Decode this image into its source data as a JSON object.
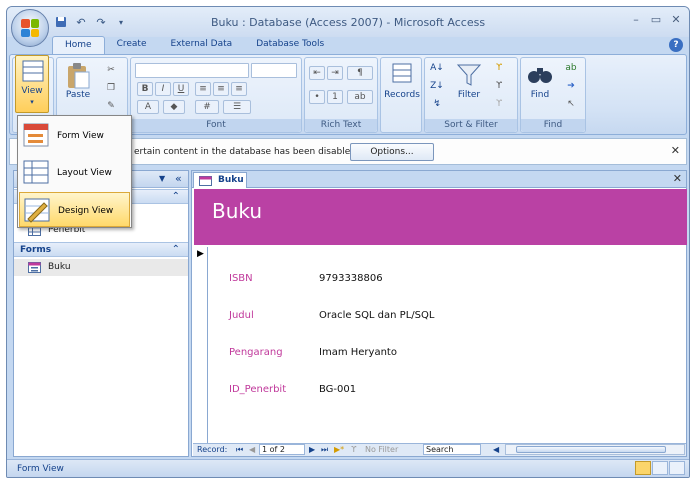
{
  "window": {
    "title": "Buku : Database (Access 2007) - Microsoft Access"
  },
  "ribbon_tabs": [
    "Home",
    "Create",
    "External Data",
    "Database Tools"
  ],
  "ribbon": {
    "view_label": "View",
    "paste_label": "Paste",
    "font_group": "Font",
    "rich_text_group": "Rich Text",
    "records_label": "Records",
    "filter_label": "Filter",
    "sort_filter_group": "Sort & Filter",
    "find_label": "Find",
    "find_group": "Find"
  },
  "security_bar": {
    "message": "ertain content in the database has been disabled",
    "options_label": "Options..."
  },
  "view_menu": [
    {
      "label": "Form View"
    },
    {
      "label": "Layout View"
    },
    {
      "label": "Design View"
    }
  ],
  "nav_pane": {
    "tables_item": "Penerbit",
    "forms_section": "Forms",
    "forms_item": "Buku"
  },
  "document": {
    "tab_label": "Buku",
    "form_title": "Buku",
    "fields": [
      {
        "label": "ISBN",
        "value": "9793338806"
      },
      {
        "label": "Judul",
        "value": "Oracle SQL dan PL/SQL"
      },
      {
        "label": "Pengarang",
        "value": "Imam Heryanto"
      },
      {
        "label": "ID_Penerbit",
        "value": "BG-001"
      }
    ]
  },
  "record_nav": {
    "label": "Record:",
    "position": "1 of 2",
    "filter": "No Filter",
    "search": "Search"
  },
  "status_bar": {
    "text": "Form View"
  },
  "colors": {
    "form_header": "#ba41a4",
    "field_label": "#c0399b",
    "ribbon_text": "#15428b"
  }
}
